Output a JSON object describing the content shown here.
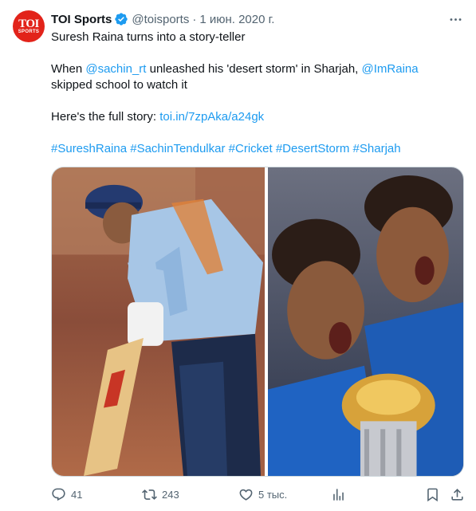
{
  "author": {
    "avatar_text_main": "TOI",
    "avatar_text_sub": "SPORTS",
    "name": "TOI Sports",
    "handle": "@toisports",
    "separator": "·",
    "date": "1 июн. 2020 г."
  },
  "tweet": {
    "line1": "Suresh Raina turns into a story-teller",
    "line2_prefix": "When ",
    "mention1": "@sachin_rt",
    "line2_middle": " unleashed his 'desert storm' in Sharjah, ",
    "mention2": "@ImRaina",
    "line2_suffix": "skipped school to watch it",
    "line3_prefix": "Here's the full story: ",
    "link": "toi.in/7zpAka/a24gk",
    "hashtags": [
      "#SureshRaina",
      "#SachinTendulkar",
      "#Cricket",
      "#DesertStorm",
      "#Sharjah"
    ]
  },
  "actions": {
    "replies": "41",
    "retweets": "243",
    "likes": "5 тыс."
  },
  "colors": {
    "link": "#1d9bf0",
    "verified": "#1d9bf0",
    "muted": "#536471",
    "avatar_bg": "#e2231a"
  },
  "icons": [
    "verified-badge-icon",
    "more-icon",
    "reply-icon",
    "retweet-icon",
    "like-icon",
    "views-icon",
    "bookmark-icon",
    "share-icon"
  ]
}
